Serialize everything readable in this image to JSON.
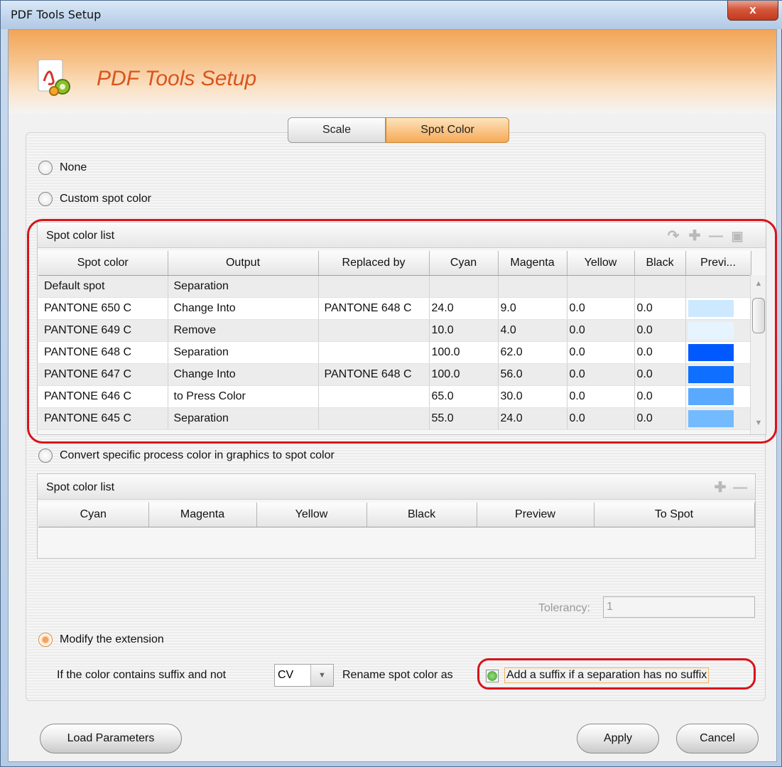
{
  "window": {
    "title": "PDF Tools Setup",
    "close_label": "x"
  },
  "banner": {
    "title": "PDF Tools Setup"
  },
  "tabs": [
    {
      "label": "Scale"
    },
    {
      "label": "Spot Color"
    }
  ],
  "options": {
    "none_label": "None",
    "custom_label": "Custom spot color",
    "convert_label": "Convert specific process color in graphics to spot color",
    "modify_label": "Modify the extension"
  },
  "spot_list": {
    "title": "Spot color list",
    "columns": [
      "Spot color",
      "Output",
      "Replaced by",
      "Cyan",
      "Magenta",
      "Yellow",
      "Black",
      "Previ..."
    ],
    "rows": [
      {
        "spot": "Default spot",
        "output": "Separation",
        "replaced": "",
        "cyan": "",
        "magenta": "",
        "yellow": "",
        "black": "",
        "color": ""
      },
      {
        "spot": "PANTONE 650 C",
        "output": "Change Into",
        "replaced": "PANTONE 648 C",
        "cyan": "24.0",
        "magenta": "9.0",
        "yellow": "0.0",
        "black": "0.0",
        "color": "#cce9ff"
      },
      {
        "spot": "PANTONE 649 C",
        "output": "Remove",
        "replaced": "",
        "cyan": "10.0",
        "magenta": "4.0",
        "yellow": "0.0",
        "black": "0.0",
        "color": "#e6f4ff"
      },
      {
        "spot": "PANTONE 648 C",
        "output": "Separation",
        "replaced": "",
        "cyan": "100.0",
        "magenta": "62.0",
        "yellow": "0.0",
        "black": "0.0",
        "color": "#0059ff"
      },
      {
        "spot": "PANTONE 647 C",
        "output": "Change Into",
        "replaced": "PANTONE 648 C",
        "cyan": "100.0",
        "magenta": "56.0",
        "yellow": "0.0",
        "black": "0.0",
        "color": "#0f6fff"
      },
      {
        "spot": "PANTONE 646 C",
        "output": "to Press Color",
        "replaced": "",
        "cyan": "65.0",
        "magenta": "30.0",
        "yellow": "0.0",
        "black": "0.0",
        "color": "#59aaff"
      },
      {
        "spot": "PANTONE 645 C",
        "output": "Separation",
        "replaced": "",
        "cyan": "55.0",
        "magenta": "24.0",
        "yellow": "0.0",
        "black": "0.0",
        "color": "#73baff"
      }
    ]
  },
  "process_list": {
    "title": "Spot color list",
    "columns": [
      "Cyan",
      "Magenta",
      "Yellow",
      "Black",
      "Preview",
      "To Spot"
    ]
  },
  "tolerancy": {
    "label": "Tolerancy:",
    "value": "1"
  },
  "extension": {
    "suffix_label": "If the color contains suffix and not",
    "suffix_value": "CV",
    "rename_label": "Rename spot color as",
    "add_suffix_label": "Add a suffix if a separation has no suffix"
  },
  "buttons": {
    "load": "Load Parameters",
    "apply": "Apply",
    "cancel": "Cancel"
  },
  "colors": {
    "accent": "#f6a957",
    "highlight": "#d8131b",
    "banner_text": "#d9541e"
  }
}
